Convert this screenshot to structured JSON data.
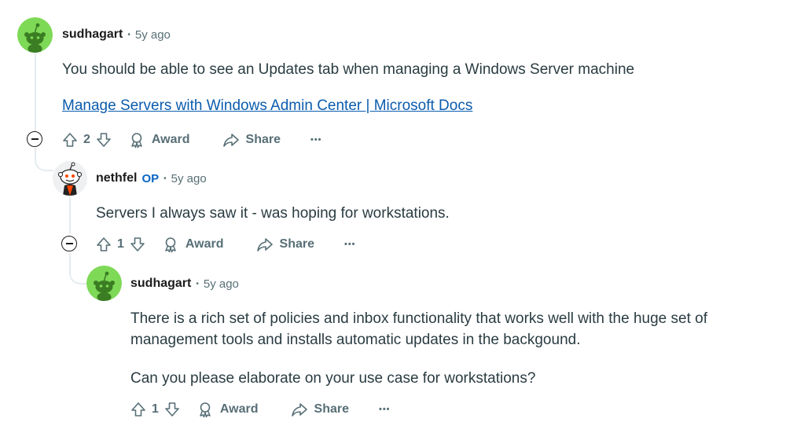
{
  "comments": [
    {
      "username": "sudhagart",
      "separator": "•",
      "time": "5y ago",
      "lines": [
        "You should be able to see an Updates tab when managing a Windows Server machine"
      ],
      "link": "Manage Servers with Windows Admin Center | Microsoft Docs",
      "votes": "2",
      "award_label": "Award",
      "share_label": "Share",
      "more_label": "•••"
    },
    {
      "username": "nethfel",
      "badge": "OP",
      "separator": "•",
      "time": "5y ago",
      "lines": [
        "Servers I always saw it - was hoping for workstations."
      ],
      "votes": "1",
      "award_label": "Award",
      "share_label": "Share",
      "more_label": "•••"
    },
    {
      "username": "sudhagart",
      "separator": "•",
      "time": "5y ago",
      "lines": [
        "There is a rich set of policies and inbox functionality that works well with the huge set of",
        "management tools and installs automatic updates in the backgound.",
        "Can you please elaborate on your use case for workstations?"
      ],
      "votes": "1",
      "award_label": "Award",
      "share_label": "Share",
      "more_label": "•••"
    }
  ],
  "colors": {
    "avatar_green": "#7ed957",
    "link": "#0b5cad",
    "muted": "#576f76",
    "op": "#0a66c2"
  }
}
